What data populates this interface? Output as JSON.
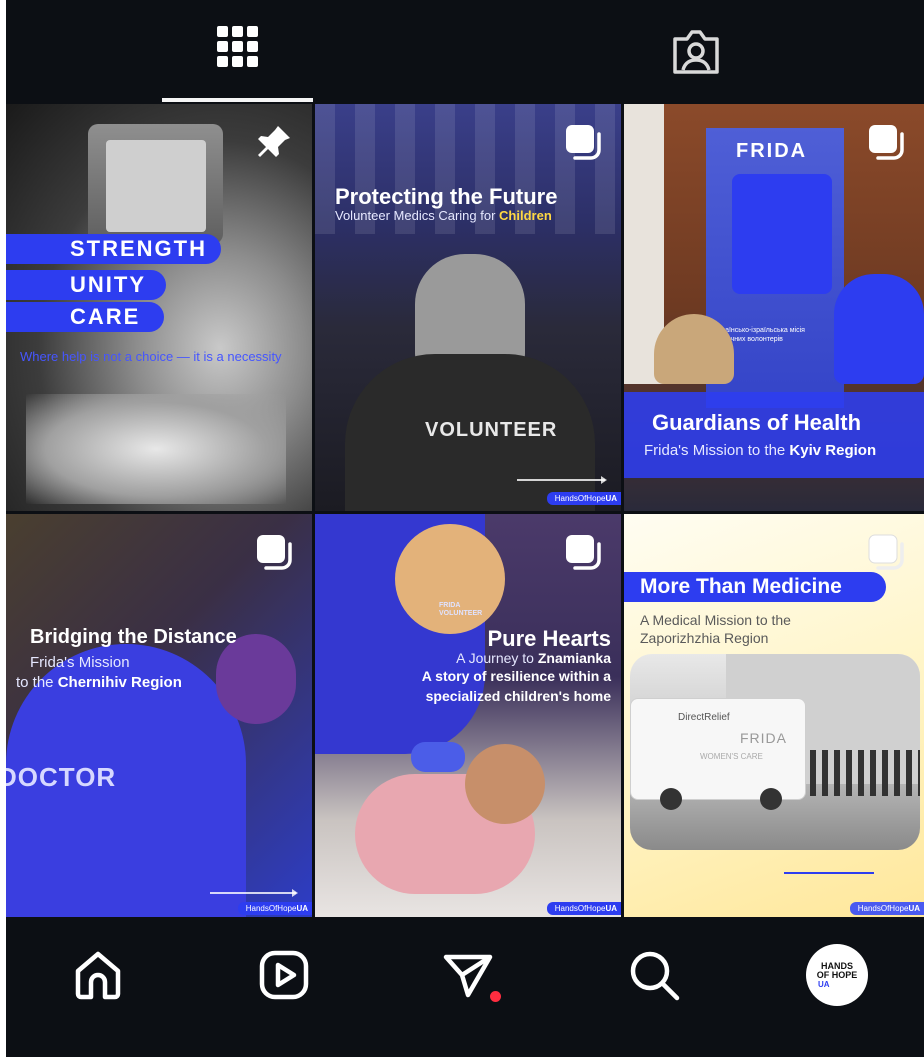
{
  "tabs": {
    "grid_icon": "grid-icon",
    "tagged_icon": "tagged-icon"
  },
  "posts": [
    {
      "pinned": true,
      "pill_1": "STRENGTH",
      "pill_2": "UNITY",
      "pill_3": "CARE",
      "subtitle": "Where help is not a choice — it is a necessity"
    },
    {
      "title": "Protecting the Future",
      "subtitle_pre": "Volunteer Medics Caring for ",
      "subtitle_accent": "Children",
      "shirt_text": "VOLUNTEER",
      "handle_pre": "HandsOfHope",
      "handle_ua": "UA"
    },
    {
      "banner": "FRIDA",
      "banner_caption": "Українсько-ізраїльська місія медичних волонтерів",
      "title": "Guardians of Health",
      "subtitle_pre": "Frida's Mission to the ",
      "subtitle_accent": "Kyiv Region"
    },
    {
      "title": "Bridging the Distance",
      "subtitle_line1": "Frida's Mission",
      "subtitle_pre": "to the ",
      "subtitle_accent": "Chernihiv Region",
      "shirt_text": "DOCTOR",
      "handle_pre": "HandsOfHope",
      "handle_ua": "UA"
    },
    {
      "title": "Pure Hearts",
      "subtitle_pre": "A Journey to ",
      "subtitle_accent": "Znamianka",
      "desc_line1": "A story of resilience within a",
      "desc_line2": "specialized children's home",
      "shirt_text": "FRIDA VOLUNTEER",
      "handle_pre": "HandsOfHope",
      "handle_ua": "UA"
    },
    {
      "title": "More Than Medicine",
      "subtitle_line1": "A Medical Mission to the",
      "subtitle_line2": "Zaporizhzhia Region",
      "van_text_1": "DirectRelief",
      "van_text_2": "FRIDA",
      "van_text_3": "WOMEN'S CARE",
      "handle_pre": "HandsOfHope",
      "handle_ua": "UA"
    }
  ],
  "bottom_nav": {
    "home": "home-icon",
    "reels": "reels-icon",
    "messages": "direct-messages-icon",
    "search": "search-icon",
    "profile_line1": "HANDS",
    "profile_line2": "OF HOPE",
    "profile_line3": "UA"
  },
  "colors": {
    "background": "#0c0f14",
    "brand_blue": "#2d3df0",
    "accent_yellow": "#ffd843",
    "notification_red": "#ff2d40"
  }
}
